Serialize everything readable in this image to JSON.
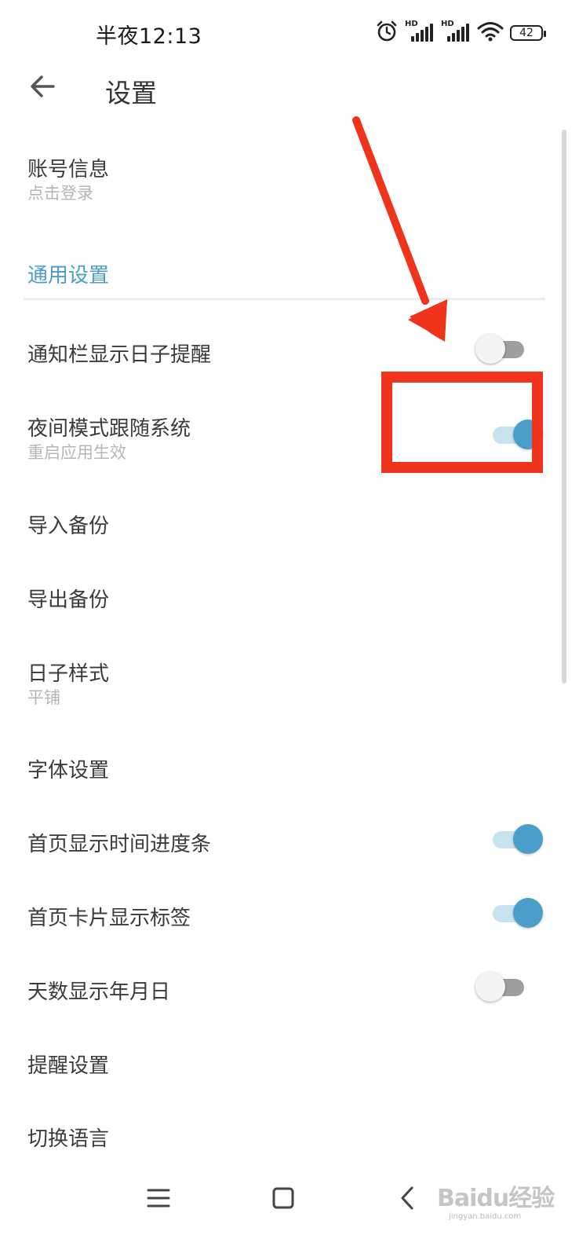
{
  "status_bar": {
    "time": "半夜12:13",
    "hd_label": "HD",
    "battery": "42",
    "icons": [
      "alarm-icon",
      "signal-icon",
      "signal-icon",
      "wifi-icon",
      "battery-icon"
    ]
  },
  "header": {
    "title": "设置",
    "back_icon": "arrow-left-icon"
  },
  "account": {
    "title": "账号信息",
    "subtitle": "点击登录"
  },
  "section_general": "通用设置",
  "settings": [
    {
      "title": "通知栏显示日子提醒",
      "toggle": false
    },
    {
      "title": "夜间模式跟随系统",
      "subtitle": "重启应用生效",
      "toggle": true
    },
    {
      "title": "导入备份"
    },
    {
      "title": "导出备份"
    },
    {
      "title": "日子样式",
      "subtitle": "平铺"
    },
    {
      "title": "字体设置"
    },
    {
      "title": "首页显示时间进度条",
      "toggle": true
    },
    {
      "title": "首页卡片显示标签",
      "toggle": true
    },
    {
      "title": "天数显示年月日",
      "toggle": false
    },
    {
      "title": "提醒设置"
    },
    {
      "title": "切换语言"
    }
  ],
  "nav": {
    "icons": [
      "menu-icon",
      "home-square-icon",
      "back-chevron-icon"
    ]
  },
  "watermark": {
    "text": "Baidu经验",
    "sub": "jingyan.baidu.com"
  },
  "colors": {
    "accent": "#4a9ec9",
    "annotation": "#f0341c"
  }
}
